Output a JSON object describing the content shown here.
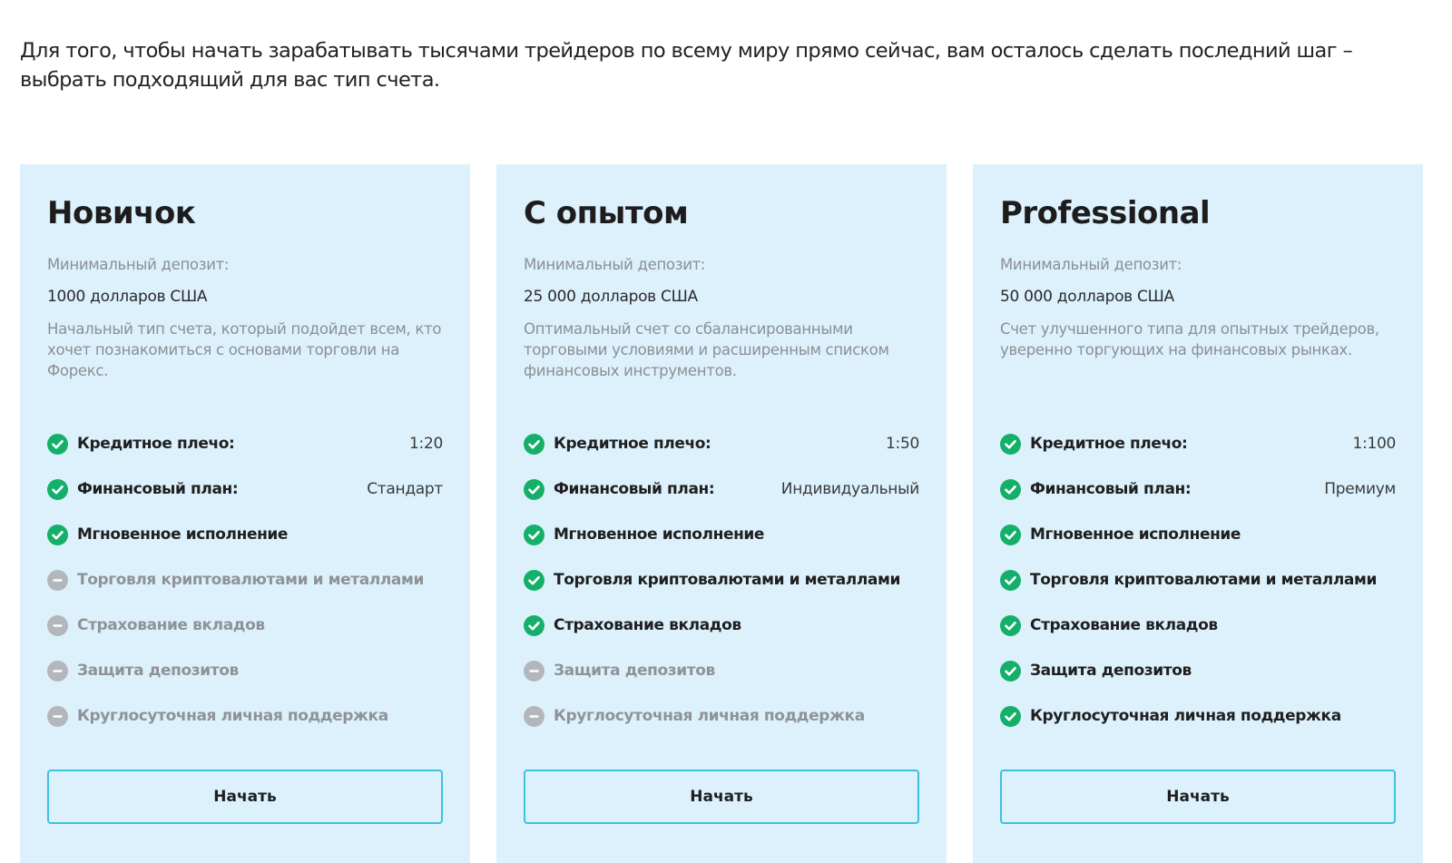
{
  "intro": {
    "line1": "Для того, чтобы начать зарабатывать тысячами трейдеров по всему миру прямо сейчас, вам осталось сделать последний шаг –",
    "line2": "выбрать подходящий для вас тип счета."
  },
  "colors": {
    "card_bg": "#ddf1fc",
    "check_on": "#14b06a",
    "check_off": "#b3b7bc",
    "button_border": "#3dc1e0"
  },
  "cards": [
    {
      "title": "Новичок",
      "deposit_label": "Минимальный депозит:",
      "deposit_value": "1000 долларов США",
      "description": "Начальный тип счета, который подойдет всем, кто хочет познакомиться с основами торговли на Форекс.",
      "features": [
        {
          "name": "Кредитное плечо:",
          "value": "1:20",
          "enabled": true,
          "icon": "check-icon"
        },
        {
          "name": "Финансовый план:",
          "value": "Стандарт",
          "enabled": true,
          "icon": "check-icon"
        },
        {
          "name": "Мгновенное исполнение",
          "value": "",
          "enabled": true,
          "icon": "check-icon"
        },
        {
          "name": "Торговля криптовалютами и металлами",
          "value": "",
          "enabled": false,
          "icon": "minus-icon"
        },
        {
          "name": "Страхование вкладов",
          "value": "",
          "enabled": false,
          "icon": "minus-icon"
        },
        {
          "name": "Защита депозитов",
          "value": "",
          "enabled": false,
          "icon": "minus-icon"
        },
        {
          "name": "Круглосуточная личная поддержка",
          "value": "",
          "enabled": false,
          "icon": "minus-icon"
        }
      ],
      "button_label": "Начать"
    },
    {
      "title": "С опытом",
      "deposit_label": "Минимальный депозит:",
      "deposit_value": "25 000 долларов США",
      "description": "Оптимальный счет со сбалансированными торговыми условиями и расширенным списком финансовых инструментов.",
      "features": [
        {
          "name": "Кредитное плечо:",
          "value": "1:50",
          "enabled": true,
          "icon": "check-icon"
        },
        {
          "name": "Финансовый план:",
          "value": "Индивидуальный",
          "enabled": true,
          "icon": "check-icon"
        },
        {
          "name": "Мгновенное исполнение",
          "value": "",
          "enabled": true,
          "icon": "check-icon"
        },
        {
          "name": "Торговля криптовалютами и металлами",
          "value": "",
          "enabled": true,
          "icon": "check-icon"
        },
        {
          "name": "Страхование вкладов",
          "value": "",
          "enabled": true,
          "icon": "check-icon"
        },
        {
          "name": "Защита депозитов",
          "value": "",
          "enabled": false,
          "icon": "minus-icon"
        },
        {
          "name": "Круглосуточная личная поддержка",
          "value": "",
          "enabled": false,
          "icon": "minus-icon"
        }
      ],
      "button_label": "Начать"
    },
    {
      "title": "Professional",
      "deposit_label": "Минимальный депозит:",
      "deposit_value": "50 000 долларов США",
      "description": "Счет улучшенного типа для опытных трейдеров, уверенно торгующих на финансовых рынках.",
      "features": [
        {
          "name": "Кредитное плечо:",
          "value": "1:100",
          "enabled": true,
          "icon": "check-icon"
        },
        {
          "name": "Финансовый план:",
          "value": "Премиум",
          "enabled": true,
          "icon": "check-icon"
        },
        {
          "name": "Мгновенное исполнение",
          "value": "",
          "enabled": true,
          "icon": "check-icon"
        },
        {
          "name": "Торговля криптовалютами и металлами",
          "value": "",
          "enabled": true,
          "icon": "check-icon"
        },
        {
          "name": "Страхование вкладов",
          "value": "",
          "enabled": true,
          "icon": "check-icon"
        },
        {
          "name": "Защита депозитов",
          "value": "",
          "enabled": true,
          "icon": "check-icon"
        },
        {
          "name": "Круглосуточная личная поддержка",
          "value": "",
          "enabled": true,
          "icon": "check-icon"
        }
      ],
      "button_label": "Начать"
    }
  ]
}
